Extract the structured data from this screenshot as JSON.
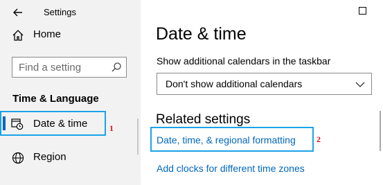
{
  "window": {
    "title": "Settings"
  },
  "sidebar": {
    "home_label": "Home",
    "search_placeholder": "Find a setting",
    "section_title": "Time & Language",
    "items": [
      {
        "label": "Date & time",
        "icon": "clock-calendar-icon",
        "selected": true,
        "annotation": "1"
      },
      {
        "label": "Region",
        "icon": "globe-icon",
        "selected": false
      }
    ]
  },
  "main": {
    "title": "Date & time",
    "calendars": {
      "label": "Show additional calendars in the taskbar",
      "selected": "Don't show additional calendars"
    },
    "related": {
      "title": "Related settings",
      "links": [
        {
          "label": "Date, time, & regional formatting",
          "annotation": "2"
        },
        {
          "label": "Add clocks for different time zones"
        }
      ]
    }
  },
  "colors": {
    "accent": "#0067c0",
    "highlight_border": "#1aa3e8",
    "annotation": "#e01010",
    "sidebar_bg": "#f2f2f2"
  }
}
